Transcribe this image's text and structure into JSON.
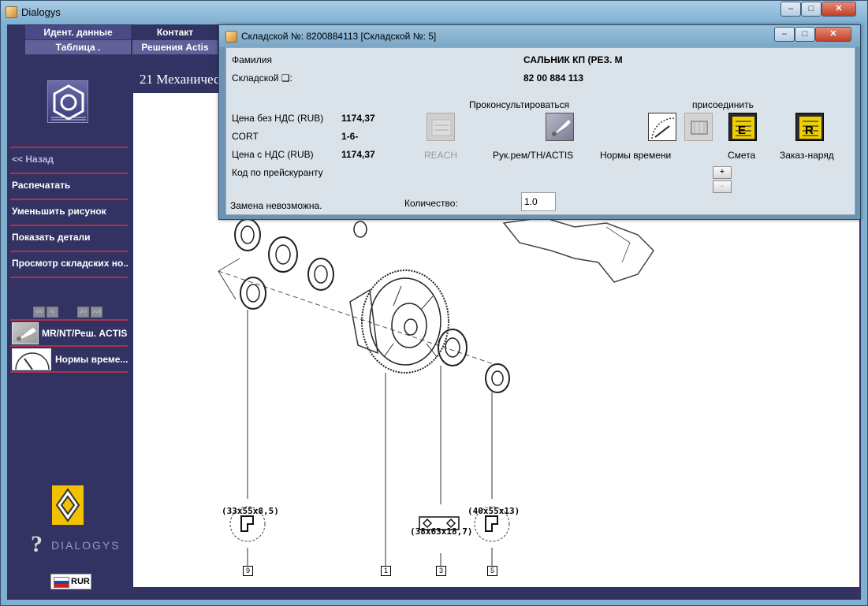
{
  "window": {
    "title": "Dialogys",
    "controls": [
      "–",
      "□",
      "✕"
    ]
  },
  "topnav": {
    "ident": "Идент. данные",
    "contact": "Контакт",
    "table": "Таблица .",
    "actis": "Решения Actis"
  },
  "headline": "21 Механичес",
  "sidebar": {
    "items": [
      "<< Назад",
      "Распечатать",
      "Уменьшить рисунок",
      "Показать детали",
      "Просмотр складских но..."
    ],
    "nav": [
      "<<",
      "<",
      ">>",
      ">>|"
    ],
    "tools": [
      "MR/NT/Реш. ACTIS",
      "Нормы време..."
    ],
    "brand": "DIALOGYS",
    "currency": "RUR"
  },
  "dialog": {
    "title": "Складской №: 8200884113 [Складской №: 5]",
    "controls": [
      "–",
      "□",
      "✕"
    ],
    "fields": {
      "surname_label": "Фамилия",
      "surname_value": "САЛЬНИК КП (РЕЗ. М",
      "stock_label": "Складской ❑:",
      "stock_value": "82 00 884 113",
      "price_no_vat_label": "Цена без НДС (RUB)",
      "price_no_vat_value": "1174,37",
      "cort_label": "CORT",
      "cort_value": "1-6-",
      "price_vat_label": "Цена с НДС (RUB)",
      "price_vat_value": "1174,37",
      "price_code_label": "Код по прейскуранту",
      "quantity_label": "Количество:",
      "quantity_value": "1.0",
      "status": "Замена невозможна."
    },
    "headers": {
      "consult": "Проконсультироваться",
      "attach": "присоединить"
    },
    "actions": {
      "reach": "REACH",
      "manual": "Рук.рем/ТН/ACTIS",
      "norms": "Нормы времени",
      "estimate": "Смета",
      "order": "Заказ-наряд",
      "plus": "+",
      "minus": "-"
    }
  },
  "diagram": {
    "callouts": [
      {
        "dims": "(33x55x8,5)",
        "num": "9"
      },
      {
        "dims": "(38x63x18,7)",
        "num": "3"
      },
      {
        "dims": "(40x55x13)",
        "num": "5"
      },
      {
        "dims": "",
        "num": "1"
      }
    ]
  },
  "colors": {
    "sidebar_bg": "#333363",
    "separator": "#b0304a",
    "dialog_bg": "#dbe3ea",
    "title_bar": "#7fafd0"
  }
}
